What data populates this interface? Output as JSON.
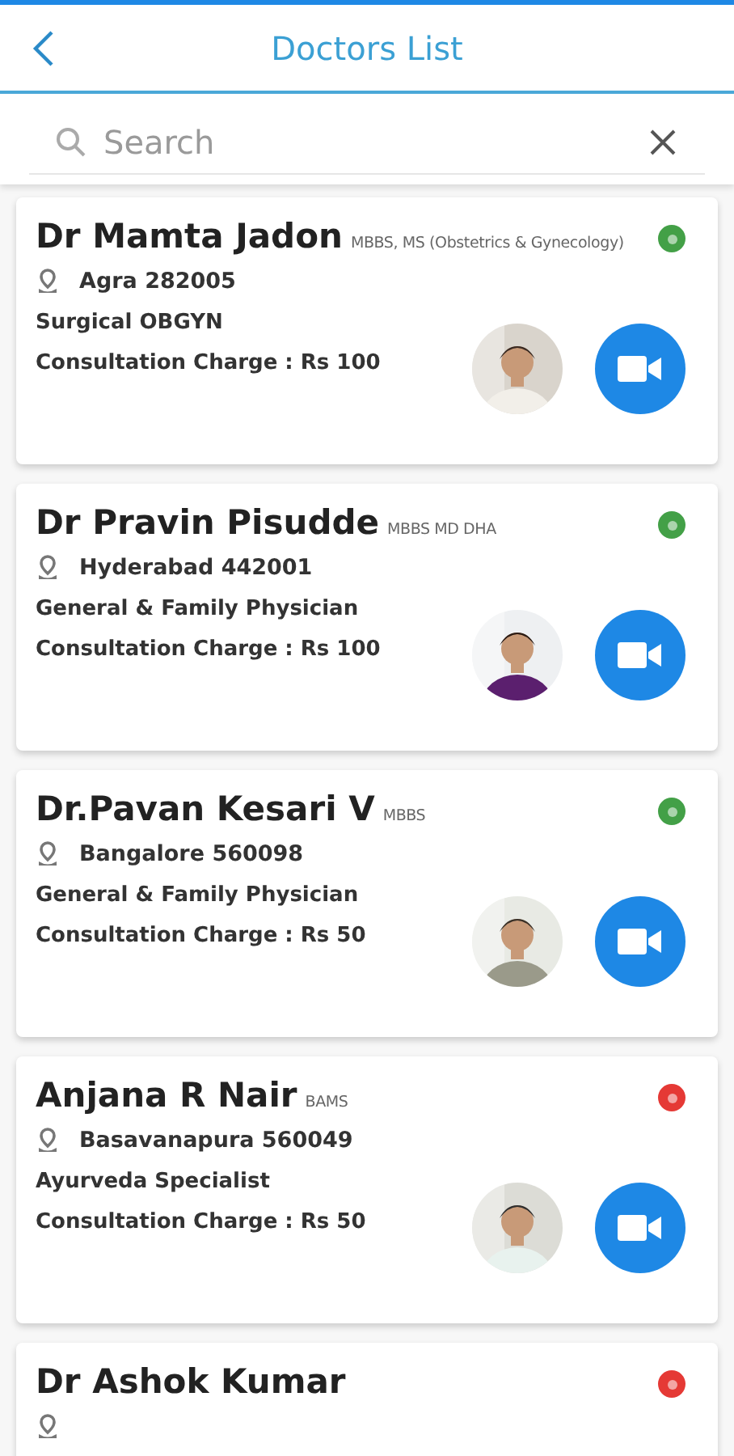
{
  "header": {
    "title": "Doctors List"
  },
  "search": {
    "placeholder": "Search"
  },
  "doctors": [
    {
      "name": "Dr Mamta Jadon",
      "degree": "MBBS, MS (Obstetrics & Gynecology)",
      "location": "Agra 282005",
      "specialty": "Surgical OBGYN",
      "charge": "Consultation Charge : Rs 100",
      "color": "#43a047"
    },
    {
      "name": "Dr Pravin  Pisudde",
      "degree": "MBBS MD DHA",
      "location": "Hyderabad 442001",
      "specialty": "General & Family Physician",
      "charge": "Consultation Charge : Rs 100",
      "color": "#43a047"
    },
    {
      "name": "Dr.Pavan Kesari V",
      "degree": "MBBS",
      "location": "Bangalore 560098",
      "specialty": "General & Family Physician",
      "charge": "Consultation Charge : Rs 50",
      "color": "#43a047"
    },
    {
      "name": "Anjana R Nair",
      "degree": "BAMS",
      "location": "Basavanapura 560049",
      "specialty": "Ayurveda Specialist",
      "charge": "Consultation Charge : Rs 50",
      "color": "#e53935"
    },
    {
      "name": "Dr Ashok Kumar",
      "color": "#e53935"
    }
  ]
}
